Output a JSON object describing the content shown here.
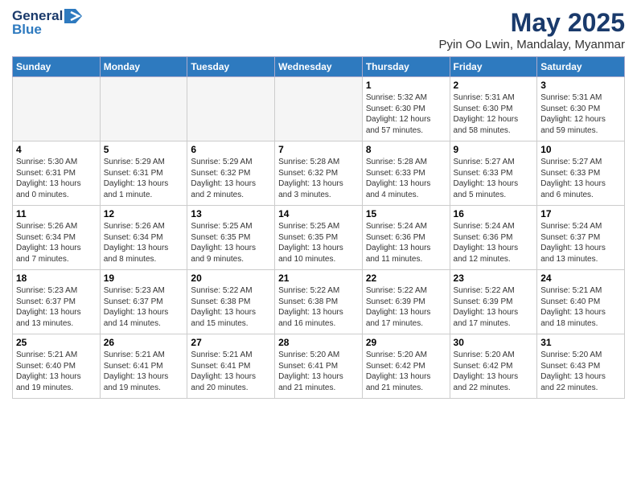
{
  "header": {
    "logo_line1": "General",
    "logo_line2": "Blue",
    "month_year": "May 2025",
    "location": "Pyin Oo Lwin, Mandalay, Myanmar"
  },
  "weekdays": [
    "Sunday",
    "Monday",
    "Tuesday",
    "Wednesday",
    "Thursday",
    "Friday",
    "Saturday"
  ],
  "weeks": [
    [
      {
        "day": "",
        "info": ""
      },
      {
        "day": "",
        "info": ""
      },
      {
        "day": "",
        "info": ""
      },
      {
        "day": "",
        "info": ""
      },
      {
        "day": "1",
        "info": "Sunrise: 5:32 AM\nSunset: 6:30 PM\nDaylight: 12 hours\nand 57 minutes."
      },
      {
        "day": "2",
        "info": "Sunrise: 5:31 AM\nSunset: 6:30 PM\nDaylight: 12 hours\nand 58 minutes."
      },
      {
        "day": "3",
        "info": "Sunrise: 5:31 AM\nSunset: 6:30 PM\nDaylight: 12 hours\nand 59 minutes."
      }
    ],
    [
      {
        "day": "4",
        "info": "Sunrise: 5:30 AM\nSunset: 6:31 PM\nDaylight: 13 hours\nand 0 minutes."
      },
      {
        "day": "5",
        "info": "Sunrise: 5:29 AM\nSunset: 6:31 PM\nDaylight: 13 hours\nand 1 minute."
      },
      {
        "day": "6",
        "info": "Sunrise: 5:29 AM\nSunset: 6:32 PM\nDaylight: 13 hours\nand 2 minutes."
      },
      {
        "day": "7",
        "info": "Sunrise: 5:28 AM\nSunset: 6:32 PM\nDaylight: 13 hours\nand 3 minutes."
      },
      {
        "day": "8",
        "info": "Sunrise: 5:28 AM\nSunset: 6:33 PM\nDaylight: 13 hours\nand 4 minutes."
      },
      {
        "day": "9",
        "info": "Sunrise: 5:27 AM\nSunset: 6:33 PM\nDaylight: 13 hours\nand 5 minutes."
      },
      {
        "day": "10",
        "info": "Sunrise: 5:27 AM\nSunset: 6:33 PM\nDaylight: 13 hours\nand 6 minutes."
      }
    ],
    [
      {
        "day": "11",
        "info": "Sunrise: 5:26 AM\nSunset: 6:34 PM\nDaylight: 13 hours\nand 7 minutes."
      },
      {
        "day": "12",
        "info": "Sunrise: 5:26 AM\nSunset: 6:34 PM\nDaylight: 13 hours\nand 8 minutes."
      },
      {
        "day": "13",
        "info": "Sunrise: 5:25 AM\nSunset: 6:35 PM\nDaylight: 13 hours\nand 9 minutes."
      },
      {
        "day": "14",
        "info": "Sunrise: 5:25 AM\nSunset: 6:35 PM\nDaylight: 13 hours\nand 10 minutes."
      },
      {
        "day": "15",
        "info": "Sunrise: 5:24 AM\nSunset: 6:36 PM\nDaylight: 13 hours\nand 11 minutes."
      },
      {
        "day": "16",
        "info": "Sunrise: 5:24 AM\nSunset: 6:36 PM\nDaylight: 13 hours\nand 12 minutes."
      },
      {
        "day": "17",
        "info": "Sunrise: 5:24 AM\nSunset: 6:37 PM\nDaylight: 13 hours\nand 13 minutes."
      }
    ],
    [
      {
        "day": "18",
        "info": "Sunrise: 5:23 AM\nSunset: 6:37 PM\nDaylight: 13 hours\nand 13 minutes."
      },
      {
        "day": "19",
        "info": "Sunrise: 5:23 AM\nSunset: 6:37 PM\nDaylight: 13 hours\nand 14 minutes."
      },
      {
        "day": "20",
        "info": "Sunrise: 5:22 AM\nSunset: 6:38 PM\nDaylight: 13 hours\nand 15 minutes."
      },
      {
        "day": "21",
        "info": "Sunrise: 5:22 AM\nSunset: 6:38 PM\nDaylight: 13 hours\nand 16 minutes."
      },
      {
        "day": "22",
        "info": "Sunrise: 5:22 AM\nSunset: 6:39 PM\nDaylight: 13 hours\nand 17 minutes."
      },
      {
        "day": "23",
        "info": "Sunrise: 5:22 AM\nSunset: 6:39 PM\nDaylight: 13 hours\nand 17 minutes."
      },
      {
        "day": "24",
        "info": "Sunrise: 5:21 AM\nSunset: 6:40 PM\nDaylight: 13 hours\nand 18 minutes."
      }
    ],
    [
      {
        "day": "25",
        "info": "Sunrise: 5:21 AM\nSunset: 6:40 PM\nDaylight: 13 hours\nand 19 minutes."
      },
      {
        "day": "26",
        "info": "Sunrise: 5:21 AM\nSunset: 6:41 PM\nDaylight: 13 hours\nand 19 minutes."
      },
      {
        "day": "27",
        "info": "Sunrise: 5:21 AM\nSunset: 6:41 PM\nDaylight: 13 hours\nand 20 minutes."
      },
      {
        "day": "28",
        "info": "Sunrise: 5:20 AM\nSunset: 6:41 PM\nDaylight: 13 hours\nand 21 minutes."
      },
      {
        "day": "29",
        "info": "Sunrise: 5:20 AM\nSunset: 6:42 PM\nDaylight: 13 hours\nand 21 minutes."
      },
      {
        "day": "30",
        "info": "Sunrise: 5:20 AM\nSunset: 6:42 PM\nDaylight: 13 hours\nand 22 minutes."
      },
      {
        "day": "31",
        "info": "Sunrise: 5:20 AM\nSunset: 6:43 PM\nDaylight: 13 hours\nand 22 minutes."
      }
    ]
  ]
}
